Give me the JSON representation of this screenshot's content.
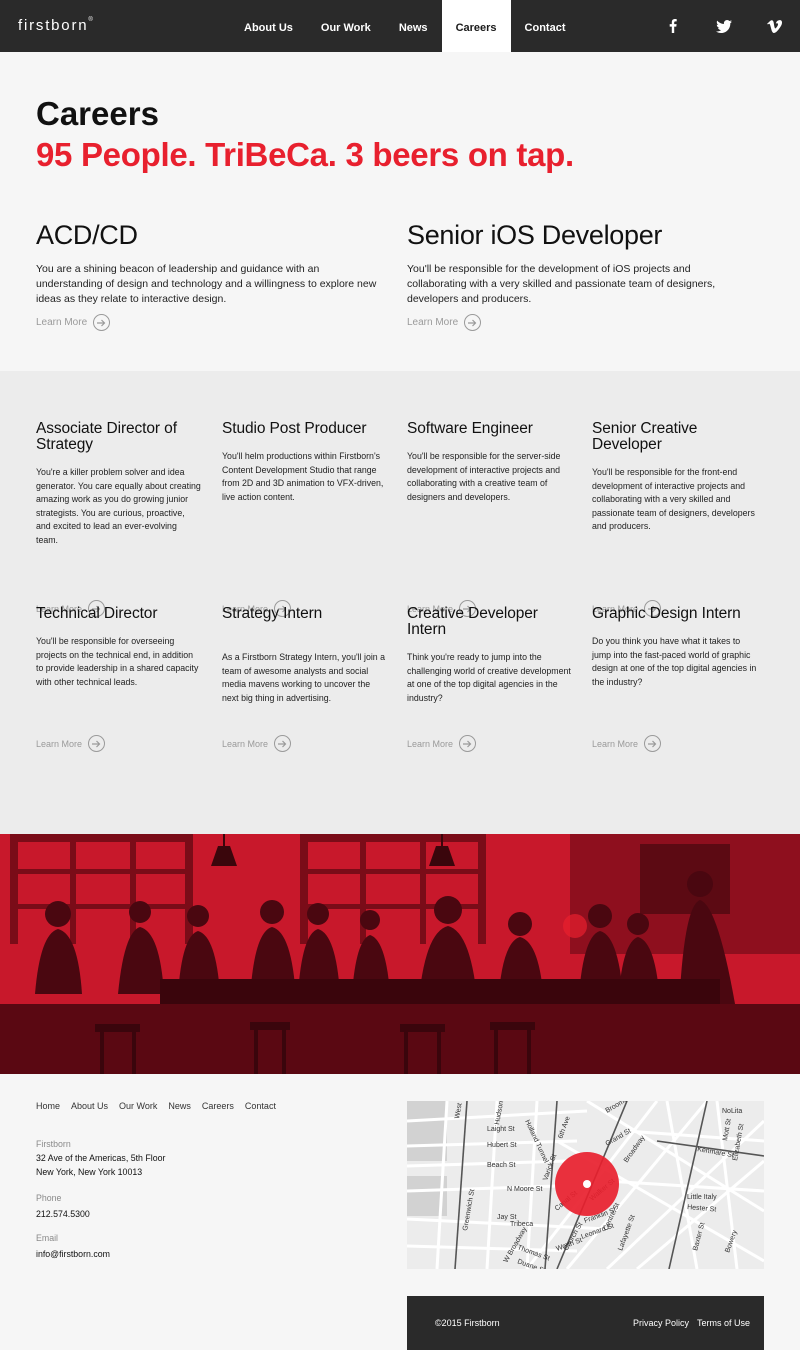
{
  "header": {
    "logo": "firstborn",
    "logo_mark": "®",
    "nav": [
      {
        "label": "About Us",
        "active": false
      },
      {
        "label": "Our Work",
        "active": false
      },
      {
        "label": "News",
        "active": false
      },
      {
        "label": "Careers",
        "active": true
      },
      {
        "label": "Contact",
        "active": false
      }
    ],
    "social_icons": [
      "facebook-icon",
      "twitter-icon",
      "vimeo-icon"
    ]
  },
  "intro": {
    "title": "Careers",
    "subtitle": "95 People. TriBeCa. 3 beers on tap."
  },
  "featured_jobs": [
    {
      "title": "ACD/CD",
      "description": "You are a shining beacon of leadership and guidance with an understanding of design and technology and a willingness to explore new ideas as they relate to interactive design.",
      "link": "Learn More"
    },
    {
      "title": "Senior iOS Developer",
      "description": "You'll be responsible for the development of iOS projects and collaborating with a very skilled and passionate team of designers, developers and producers.",
      "link": "Learn More"
    }
  ],
  "jobs": [
    {
      "title": "Associate Director of Strategy",
      "description": "You're a killer problem solver and idea generator. You care equally about creating amazing work as you do growing junior strategists. You are curious, proactive, and excited to lead an ever-evolving team.",
      "link": "Learn More"
    },
    {
      "title": "Studio Post Producer",
      "description": "You'll helm productions within Firstborn's Content Development Studio that range from 2D and 3D animation to VFX-driven, live action content.",
      "link": "Learn More"
    },
    {
      "title": "Software Engineer",
      "description": "You'll be responsible for the server-side development of interactive projects and collaborating with a creative team of designers and developers.",
      "link": "Learn More"
    },
    {
      "title": "Senior Creative Developer",
      "description": "You'll be responsible for the front-end development of interactive projects and collaborating with a very skilled and passionate team of designers, developers and producers.",
      "link": "Learn More"
    },
    {
      "title": "Technical Director",
      "description": "You'll be responsible for overseeing projects on the technical end, in addition to provide leadership in a shared capacity with other technical leads.",
      "link": "Learn More"
    },
    {
      "title": "Strategy Intern",
      "description": "As a Firstborn Strategy Intern, you'll join a team of awesome analysts and social media mavens working to uncover the next big thing in advertising.",
      "link": "Learn More"
    },
    {
      "title": "Creative Developer Intern",
      "description": "Think you're ready to jump into the challenging world of creative development at one of the top digital agencies in the industry?",
      "link": "Learn More"
    },
    {
      "title": "Graphic Design Intern",
      "description": "Do you think you have what it takes to jump into the fast-paced world of graphic design at one of the top digital agencies in the industry?",
      "link": "Learn More"
    }
  ],
  "footer": {
    "nav": [
      "Home",
      "About Us",
      "Our Work",
      "News",
      "Careers",
      "Contact"
    ],
    "company_label": "Firstborn",
    "address_line1": "32 Ave of the Americas, 5th Floor",
    "address_line2": "New York, New York 10013",
    "phone_label": "Phone",
    "phone": "212.574.5300",
    "email_label": "Email",
    "email": "info@firstborn.com",
    "copyright": "©2015 Firstborn",
    "privacy": "Privacy Policy",
    "terms": "Terms of Use"
  },
  "map": {
    "streets": [
      "West St",
      "Greenwich St",
      "Hudson St",
      "Laight St",
      "Hubert St",
      "Beach St",
      "N Moore St",
      "Varick St",
      "Holland Tunnel",
      "6th Ave",
      "Broome St",
      "Grand St",
      "Broadway",
      "Lafayette St",
      "Canal St",
      "Walker St",
      "Franklin St",
      "Leonard St",
      "Worth St",
      "Thomas St",
      "Duane St",
      "W Broadway",
      "Church St",
      "Jay St",
      "Tribeca",
      "Kenmare St",
      "Mott St",
      "Elizabeth St",
      "Hester St",
      "Little Italy",
      "NoLita",
      "Bowery",
      "Baxter St",
      "Centre St"
    ]
  },
  "colors": {
    "brand_red": "#e8202e",
    "dark_bar": "#2a2a2a",
    "photo_red": "#c6152a"
  }
}
